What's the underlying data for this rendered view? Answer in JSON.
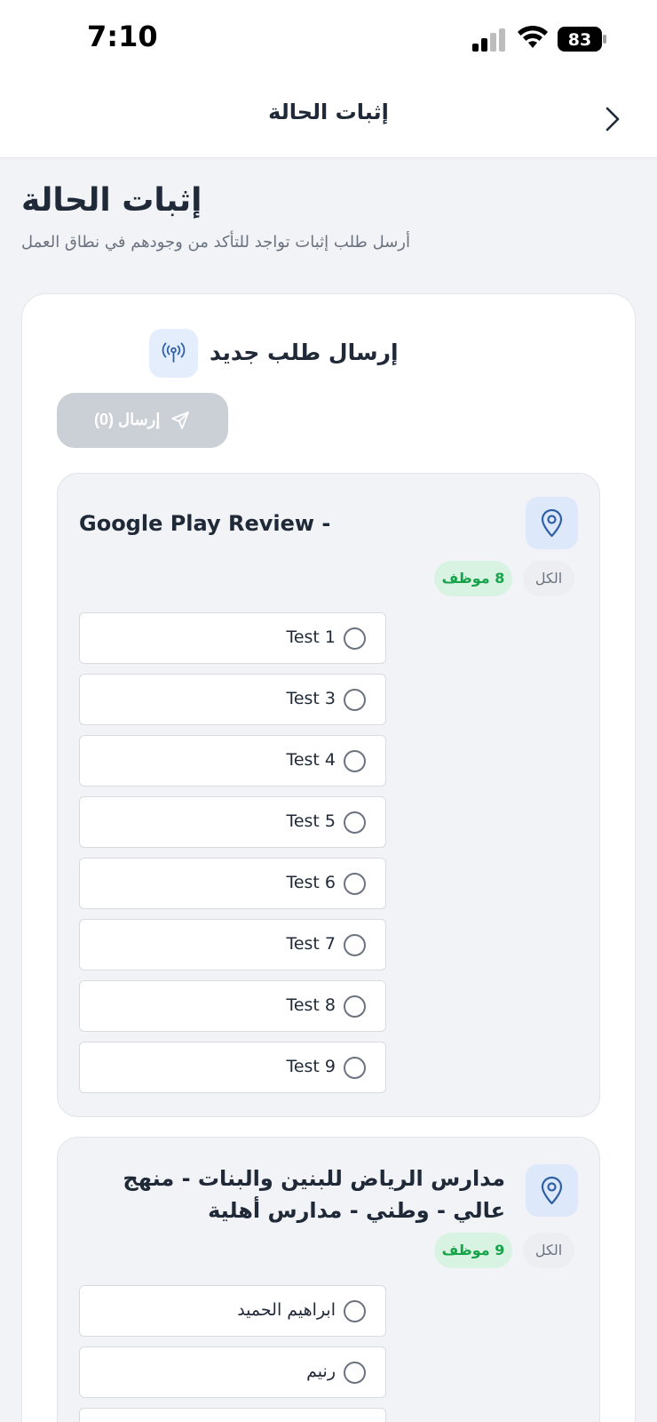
{
  "status_bar": {
    "time": "7:10",
    "battery": "83"
  },
  "nav": {
    "title": "إثبات الحالة"
  },
  "header": {
    "title": "إثبات الحالة",
    "subtitle": "أرسل طلب إثبات تواجد للتأكد من وجودهم في نطاق العمل"
  },
  "request": {
    "title": "إرسال طلب جديد",
    "send_label": "إرسال (0)"
  },
  "locations": [
    {
      "name": "Google Play Review -",
      "all_label": "الكل",
      "count_label": "8 موظف",
      "employees": [
        "Test 1",
        "Test 3",
        "Test 4",
        "Test 5",
        "Test 6",
        "Test 7",
        "Test 8",
        "Test 9"
      ]
    },
    {
      "name": "مدارس الرياض للبنين والبنات - منهج عالي - وطني - مدارس أهلية",
      "all_label": "الكل",
      "count_label": "9 موظف",
      "employees": [
        "ابراهيم الحميد",
        "رنيم",
        ""
      ]
    }
  ],
  "colors": {
    "accent_blue": "#2f5fa7",
    "count_green": "#16a34a",
    "disabled_button": "#cbd0d7"
  }
}
